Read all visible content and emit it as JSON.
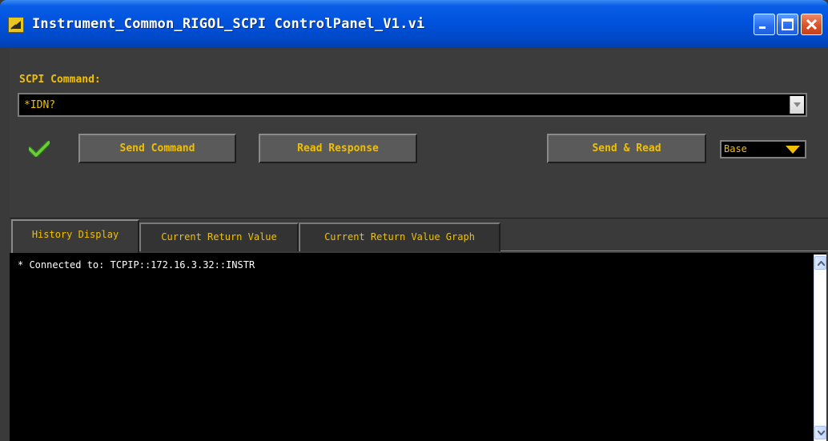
{
  "window": {
    "title": "Instrument_Common_RIGOL_SCPI ControlPanel_V1.vi"
  },
  "command": {
    "label": "SCPI Command:",
    "value": "*IDN?"
  },
  "buttons": {
    "send_command": "Send Command",
    "read_response": "Read Response",
    "send_and_read": "Send & Read"
  },
  "format_ring": {
    "value": "Base"
  },
  "tabs": [
    {
      "label": "History Display",
      "active": true
    },
    {
      "label": "Current Return Value",
      "active": false
    },
    {
      "label": "Current Return Value Graph",
      "active": false
    }
  ],
  "history": {
    "lines": [
      "* Connected to: TCPIP::172.16.3.32::INSTR"
    ]
  },
  "icons": {
    "app": "labview-vi-icon",
    "status": "check-icon",
    "minimize": "minimize-icon",
    "maximize": "maximize-icon",
    "close": "close-icon",
    "dropdown": "chevron-down-icon"
  },
  "colors": {
    "accent": "#f0c000",
    "panel": "#3c3c3c",
    "display_bg": "#000000",
    "title_bar": "#0052dd"
  }
}
